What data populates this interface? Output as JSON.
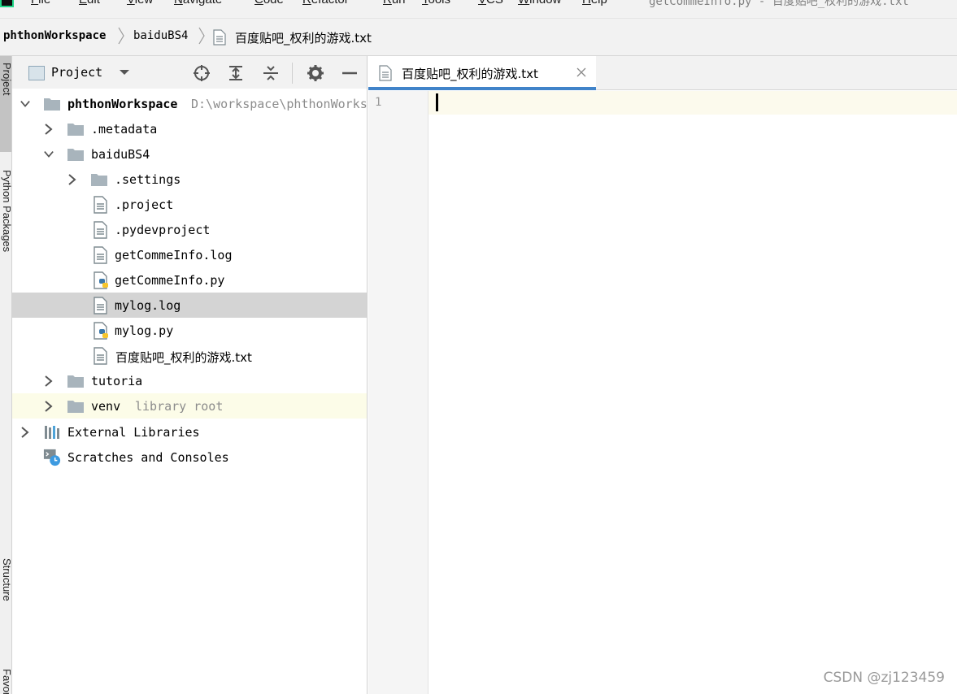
{
  "menu": {
    "items": [
      "File",
      "Edit",
      "View",
      "Navigate",
      "Code",
      "Refactor",
      "Run",
      "Tools",
      "VCS",
      "Window",
      "Help"
    ],
    "window_title": "getCommeInfo.py - 百度贴吧_权利的游戏.txt"
  },
  "breadcrumb": {
    "root": "phthonWorkspace",
    "folder": "baiduBS4",
    "file": "百度贴吧_权利的游戏.txt"
  },
  "tool_stripe": {
    "project": "Project",
    "python_packages": "Python Packages",
    "structure": "Structure",
    "favorites": "Favorites"
  },
  "project_panel": {
    "title": "Project",
    "tree": [
      {
        "label": "phthonWorkspace",
        "hint": "D:\\workspace\\phthonWorks",
        "type": "folder",
        "expanded": true
      },
      {
        "label": ".metadata",
        "type": "folder",
        "expanded": false
      },
      {
        "label": "baiduBS4",
        "type": "folder",
        "expanded": true
      },
      {
        "label": ".settings",
        "type": "folder",
        "expanded": false
      },
      {
        "label": ".project",
        "type": "file"
      },
      {
        "label": ".pydevproject",
        "type": "file"
      },
      {
        "label": "getCommeInfo.log",
        "type": "file"
      },
      {
        "label": "getCommeInfo.py",
        "type": "python"
      },
      {
        "label": "mylog.log",
        "type": "file",
        "selected": true
      },
      {
        "label": "mylog.py",
        "type": "python"
      },
      {
        "label": "百度贴吧_权利的游戏.txt",
        "type": "file"
      },
      {
        "label": "tutoria",
        "type": "folder",
        "expanded": false
      },
      {
        "label": "venv",
        "hint": "library root",
        "type": "folder",
        "expanded": false
      },
      {
        "label": "External Libraries",
        "type": "libraries",
        "expanded": false
      },
      {
        "label": "Scratches and Consoles",
        "type": "scratches"
      }
    ]
  },
  "editor": {
    "tab_label": "百度贴吧_权利的游戏.txt",
    "line_numbers": [
      "1"
    ],
    "content": ""
  },
  "watermark": "CSDN @zj123459",
  "colors": {
    "accent": "#4083c9",
    "selection": "#d4d4d4",
    "library_root_bg": "#fcfce8",
    "folder": "#a8b4bc"
  }
}
